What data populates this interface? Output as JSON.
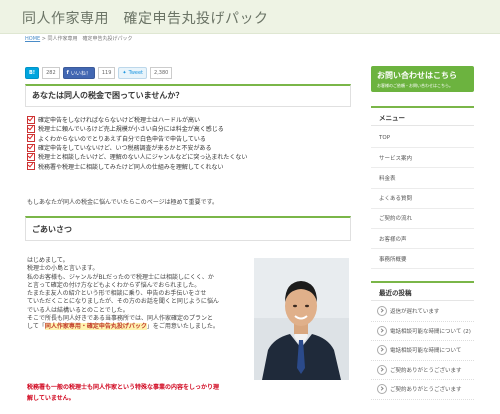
{
  "header": {
    "title": "同人作家専用　確定申告丸投げパック"
  },
  "breadcrumb": {
    "home": "HOME",
    "sep": " > ",
    "current": "同人作家専用　確定申告丸投げパック"
  },
  "social": {
    "hatena_label": "B!",
    "hatena_count": "282",
    "facebook_label": "いいね！",
    "facebook_count": "119",
    "tweet_label": "Tweet",
    "tweet_count": "2,380"
  },
  "section1": {
    "heading": "あなたは同人の税金で困っていませんか？"
  },
  "checklist": [
    "確定申告をしなければならないけど税理士はハードルが高い",
    "税理士に頼んでいるけど売上規模が小さい自分には料金が高く感じる",
    "よくわからないのでとりあえず自分で白色申告で申告している",
    "確定申告をしていないけど、いつ税務調査が来るかと不安がある",
    "税理士と相談したいけど、理解のない人にジャンルなどに突っ込まれたくない",
    "税務署や税理士に相談してみたけど同人の仕組みを理解してくれない"
  ],
  "lead": "もしあなたが同人の税金に悩んでいたらこのページは極めて重要です。",
  "section2": {
    "heading": "ごあいさつ"
  },
  "greeting": {
    "lines": [
      "はじめまして。",
      "税理士の小島と言います。",
      "私のお客様も、ジャンルがBLだったので税理士には相談しにくく、か",
      "と言って確定の付け方などもよくわからず悩んでおられました。",
      "たまたま友人の紹介という形で相談に乗り、申告のお手伝いをさせ",
      "ていただくことになりましたが、その方のお話を聞くと同じように悩ん",
      "でいる人は結構いるとのことでした。",
      "そこで所長も同人好きである当事務所では、同人作家確定のプランと"
    ],
    "last_prefix": "して「",
    "last_highlight": "同人作家専用・確定申告丸投げパック",
    "last_suffix": "」をご用意いたしました。"
  },
  "warning": {
    "lines": [
      "税務署も一般の税理士も同人作家という特殊な事業の内容をしっかり理",
      "解していません。"
    ]
  },
  "sidebar": {
    "contact": {
      "title": "お問い合わせはこちら",
      "subtitle": "お客様のご依頼・お問い合わせはこちら。"
    },
    "menu_heading": "メニュー",
    "menu_items": [
      "TOP",
      "サービス案内",
      "料金表",
      "よくある質問",
      "ご契約の流れ",
      "お客様の声",
      "事務所概要"
    ],
    "news_heading": "最近の投稿",
    "news_items": [
      "返信が遅れています",
      "電話相談可能な時間について (2)",
      "電話相談可能な時間について",
      "ご契約ありがとうございます",
      "ご契約ありがとうございます"
    ]
  }
}
